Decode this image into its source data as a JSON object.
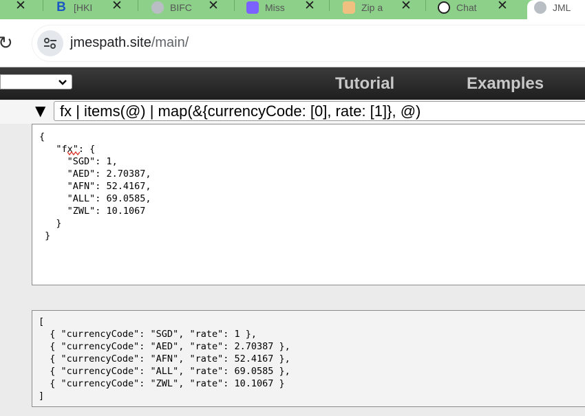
{
  "browser": {
    "tabs": [
      {
        "title": "[HKI",
        "favicon": "b-bold-icon",
        "favicon_color": "#1a56c4"
      },
      {
        "title": "BIFC",
        "favicon": "globe-icon",
        "favicon_color": "#9aa0a6"
      },
      {
        "title": "Miss",
        "favicon": "purple-app-icon",
        "favicon_color": "#7b61ff"
      },
      {
        "title": "Zip a",
        "favicon": "zip-icon",
        "favicon_color": "#e08a2b"
      },
      {
        "title": "Chat",
        "favicon": "openai-icon",
        "favicon_color": "#222222"
      },
      {
        "title": "JML",
        "favicon": "globe-icon",
        "favicon_color": "#9aa0a6"
      }
    ],
    "url_host": "jmespath.site",
    "url_path": "/main/",
    "tab_strip_color": "#8cd08a"
  },
  "header": {
    "nav": [
      "Tutorial",
      "Examples"
    ]
  },
  "expression": "fx | items(@) | map(&{currencyCode: [0], rate: [1]}, @)",
  "input_json": "{\n   \"fx\": {\n     \"SGD\": 1,\n     \"AED\": 2.70387,\n     \"AFN\": 52.4167,\n     \"ALL\": 69.0585,\n     \"ZWL\": 10.1067\n   }\n }",
  "result": "[\n  { \"currencyCode\": \"SGD\", \"rate\": 1 },\n  { \"currencyCode\": \"AED\", \"rate\": 2.70387 },\n  { \"currencyCode\": \"AFN\", \"rate\": 52.4167 },\n  { \"currencyCode\": \"ALL\", \"rate\": 69.0585 },\n  { \"currencyCode\": \"ZWL\", \"rate\": 10.1067 }\n]"
}
